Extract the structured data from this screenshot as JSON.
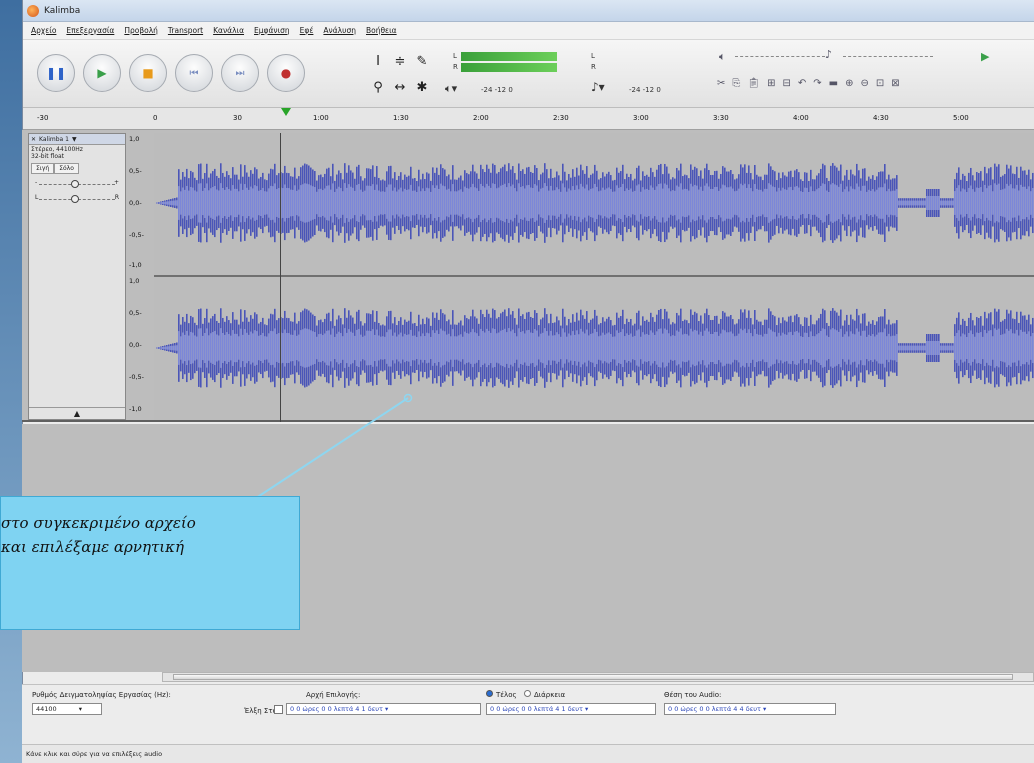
{
  "window": {
    "title": "Kalimba"
  },
  "menu": [
    "Αρχείο",
    "Επεξεργασία",
    "Προβολή",
    "Transport",
    "Κανάλια",
    "Εμφάνιση",
    "Εφέ",
    "Ανάλυση",
    "Βοήθεια"
  ],
  "meters": {
    "left_label": "L",
    "right_label": "R",
    "ticks_play": "-24  -12   0",
    "ticks_rec": "-24  -12   0"
  },
  "timeline": {
    "ticks": [
      "-30",
      "0",
      "30",
      "1:00",
      "1:30",
      "2:00",
      "2:30",
      "3:00",
      "3:30",
      "4:00",
      "4:30",
      "5:00"
    ]
  },
  "track": {
    "name": "Kalimba 1",
    "info_rate": "Στέρεο, 44100Hz",
    "info_format": "32-bit float",
    "mute_label": "Σιγή",
    "solo_label": "Σόλο",
    "gain_minus": "-",
    "gain_plus": "+",
    "pan_left": "L",
    "pan_right": "R",
    "scale_top": [
      "1,0",
      "0,5-",
      "0,0-",
      "-0,5-",
      "-1,0"
    ],
    "scale_bottom": [
      "1,0",
      "0,5-",
      "0,0-",
      "-0,5-",
      "-1,0"
    ]
  },
  "selection_bar": {
    "rate_label": "Ρυθμός Δειγματοληψίας Εργασίας (Hz):",
    "rate_value": "44100",
    "snap_label": "Έλξη Στο",
    "start_label": "Αρχή Επιλογής:",
    "start_value": "0 0 ώρες 0 0 λεπτά 4 1 δευτ ▾",
    "end_label": "Τέλος",
    "length_label": "Διάρκεια",
    "end_value": "0 0 ώρες 0 0 λεπτά 4 1 δευτ ▾",
    "audio_pos_label": "Θέση του Audio:",
    "audio_pos_value": "0 0 ώρες 0 0 λεπτά 4 4 δευτ ▾"
  },
  "status": "Κάνε κλικ και σύρε για να επιλέξεις audio",
  "callout": {
    "line1": "στο συγκεκριμένο αρχείο",
    "line2": "και επιλέξαμε αρνητική"
  },
  "colors": {
    "waveform": "#4a55b8",
    "waveform_light": "#7c87d8",
    "callout_bg": "#7fd3f2",
    "meter_green": "#4fbf44"
  }
}
